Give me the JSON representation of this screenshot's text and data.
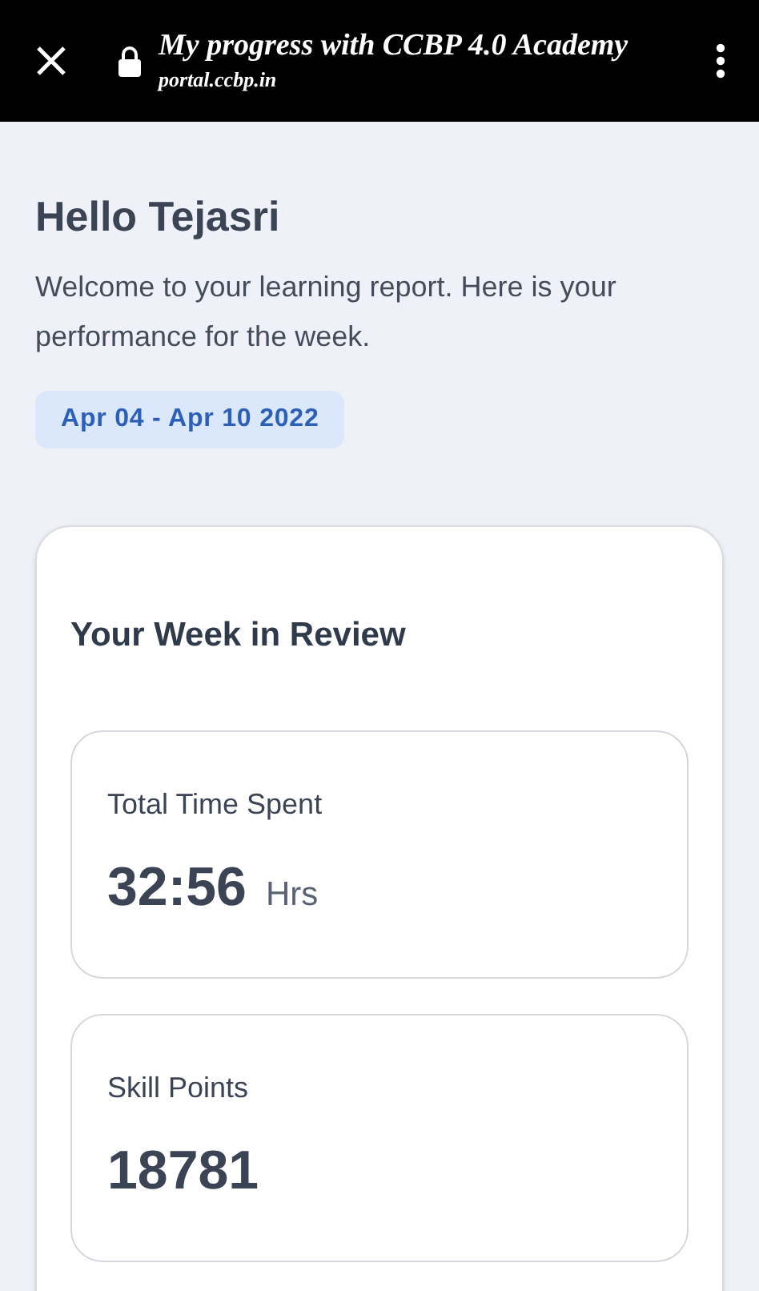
{
  "top_bar": {
    "title": "My progress with CCBP 4.0 Academy",
    "url": "portal.ccbp.in"
  },
  "greeting": "Hello Tejasri",
  "intro": "Welcome to your learning report. Here is your performance for the week.",
  "date_range": "Apr 04 - Apr 10 2022",
  "review": {
    "title": "Your Week in Review",
    "stats": [
      {
        "label": "Total Time Spent",
        "value": "32:56",
        "unit": "Hrs"
      },
      {
        "label": "Skill Points",
        "value": "18781"
      }
    ]
  }
}
